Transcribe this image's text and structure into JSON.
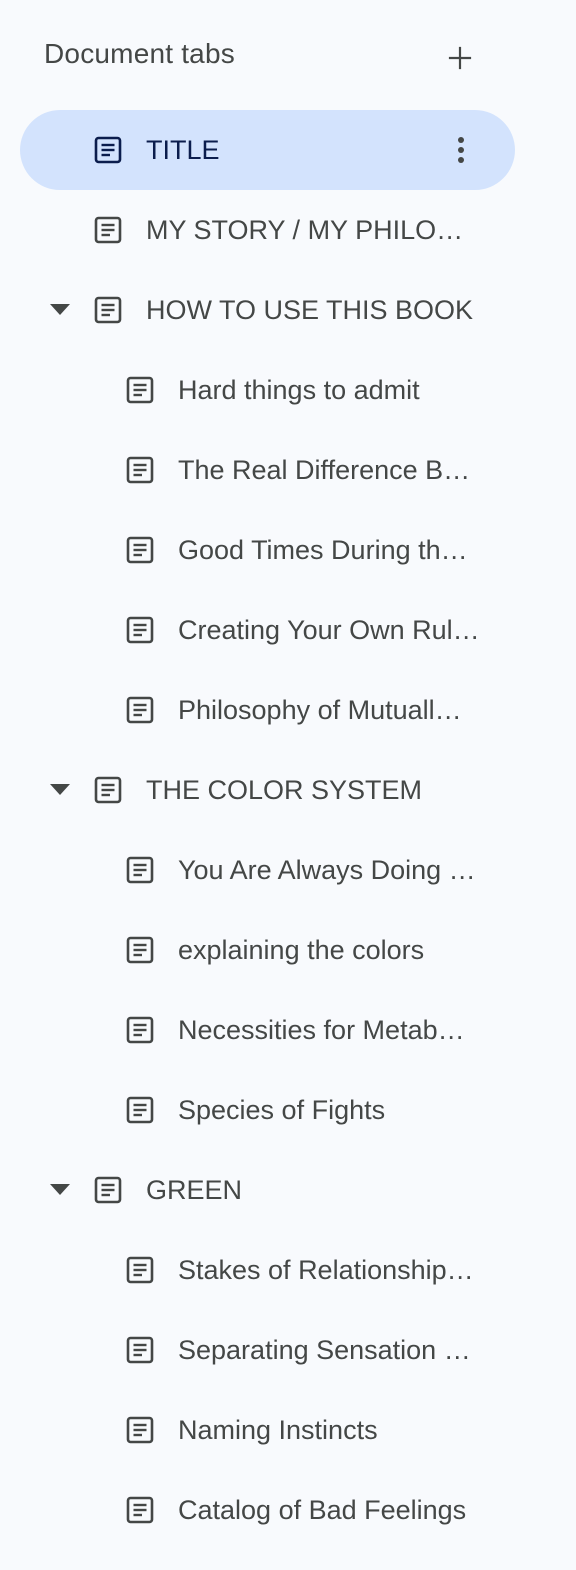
{
  "header": {
    "title": "Document tabs",
    "add_icon": "plus-icon"
  },
  "colors": {
    "background": "#f8fafd",
    "selected_bg": "#d3e3fd",
    "text": "#444746",
    "selected_text": "#0b1d4d"
  },
  "tabs": [
    {
      "label": "TITLE",
      "level": 0,
      "selected": true,
      "expandable": false
    },
    {
      "label": "MY STORY / MY PHILOS…",
      "level": 0,
      "selected": false,
      "expandable": false
    },
    {
      "label": "HOW TO USE THIS BOOK",
      "level": 0,
      "selected": false,
      "expandable": true
    },
    {
      "label": "Hard things to admit",
      "level": 1,
      "selected": false,
      "expandable": false
    },
    {
      "label": "The Real Difference B…",
      "level": 1,
      "selected": false,
      "expandable": false
    },
    {
      "label": "Good Times During th…",
      "level": 1,
      "selected": false,
      "expandable": false
    },
    {
      "label": "Creating Your Own Rul…",
      "level": 1,
      "selected": false,
      "expandable": false
    },
    {
      "label": "Philosophy of Mutuall…",
      "level": 1,
      "selected": false,
      "expandable": false
    },
    {
      "label": "THE COLOR SYSTEM",
      "level": 0,
      "selected": false,
      "expandable": true
    },
    {
      "label": "You Are Always Doing …",
      "level": 1,
      "selected": false,
      "expandable": false
    },
    {
      "label": "explaining the colors",
      "level": 1,
      "selected": false,
      "expandable": false
    },
    {
      "label": "Necessities for Metab…",
      "level": 1,
      "selected": false,
      "expandable": false
    },
    {
      "label": "Species of Fights",
      "level": 1,
      "selected": false,
      "expandable": false
    },
    {
      "label": "GREEN",
      "level": 0,
      "selected": false,
      "expandable": true
    },
    {
      "label": "Stakes of Relationship…",
      "level": 1,
      "selected": false,
      "expandable": false
    },
    {
      "label": "Separating Sensation …",
      "level": 1,
      "selected": false,
      "expandable": false
    },
    {
      "label": "Naming Instincts",
      "level": 1,
      "selected": false,
      "expandable": false
    },
    {
      "label": "Catalog of Bad Feelings",
      "level": 1,
      "selected": false,
      "expandable": false
    }
  ],
  "icons": {
    "tab": "document-icon",
    "expand": "caret-down-icon",
    "more": "more-vert-icon"
  }
}
